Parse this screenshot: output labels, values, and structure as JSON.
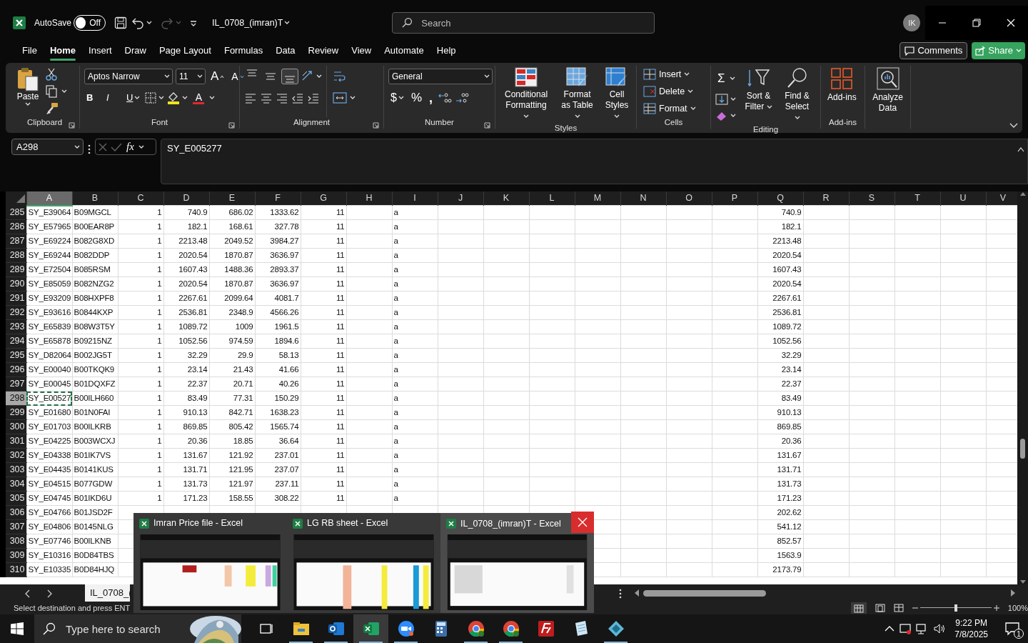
{
  "title_bar": {
    "autosave_label": "AutoSave",
    "autosave": {
      "on": false,
      "label": "Off"
    },
    "file_name": "IL_0708_(imran)T",
    "search_placeholder": "Search",
    "avatar": "IK"
  },
  "menu_tabs": [
    {
      "label": "File",
      "selected": false
    },
    {
      "label": "Home",
      "selected": true
    },
    {
      "label": "Insert",
      "selected": false
    },
    {
      "label": "Draw",
      "selected": false
    },
    {
      "label": "Page Layout",
      "selected": false
    },
    {
      "label": "Formulas",
      "selected": false
    },
    {
      "label": "Data",
      "selected": false
    },
    {
      "label": "Review",
      "selected": false
    },
    {
      "label": "View",
      "selected": false
    },
    {
      "label": "Automate",
      "selected": false
    },
    {
      "label": "Help",
      "selected": false
    }
  ],
  "comments": "Comments",
  "share": "Share",
  "ribbon": {
    "clipboard": {
      "label": "Clipboard",
      "paste": "Paste"
    },
    "font": {
      "label": "Font",
      "family": "Aptos Narrow",
      "size": "11",
      "grow": "A",
      "shrink": "A",
      "bold": "B",
      "italic": "I",
      "underline": "U",
      "color_letter": "A"
    },
    "alignment": {
      "label": "Alignment",
      "vertical": [
        {
          "selected": false
        },
        {
          "selected": false
        },
        {
          "selected": true
        }
      ]
    },
    "number": {
      "label": "Number",
      "format": "General",
      "currency": "$",
      "percent": "%",
      "comma": ","
    },
    "styles": {
      "label": "Styles",
      "buttons": [
        "Conditional Formatting",
        "Format as Table",
        "Cell Styles"
      ]
    },
    "cells": {
      "label": "Cells",
      "buttons": [
        "Insert",
        "Delete",
        "Format"
      ]
    },
    "editing": {
      "label": "Editing",
      "sum": "Σ",
      "buttons": [
        "Sort & Filter",
        "Find & Select"
      ]
    },
    "addins": {
      "label": "Add-ins",
      "button": "Add-ins"
    },
    "analyze": {
      "button": "Analyze Data"
    }
  },
  "formula_bar": {
    "name_box": "A298",
    "fx": "fx",
    "formula": "SY_E005277"
  },
  "columns": [
    {
      "letter": "A",
      "numeric": false,
      "selected": true
    },
    {
      "letter": "B",
      "numeric": false,
      "selected": false
    },
    {
      "letter": "C",
      "numeric": true,
      "selected": false
    },
    {
      "letter": "D",
      "numeric": true,
      "selected": false
    },
    {
      "letter": "E",
      "numeric": true,
      "selected": false
    },
    {
      "letter": "F",
      "numeric": true,
      "selected": false
    },
    {
      "letter": "G",
      "numeric": true,
      "selected": false
    },
    {
      "letter": "H",
      "selected": false
    },
    {
      "letter": "I",
      "numeric": false,
      "selected": false
    },
    {
      "letter": "J",
      "selected": false
    },
    {
      "letter": "K",
      "selected": false
    },
    {
      "letter": "L",
      "selected": false
    },
    {
      "letter": "M",
      "selected": false
    },
    {
      "letter": "N",
      "selected": false
    },
    {
      "letter": "O",
      "selected": false
    },
    {
      "letter": "P",
      "selected": false
    },
    {
      "letter": "Q",
      "numeric": true,
      "selected": false
    },
    {
      "letter": "R",
      "selected": false
    },
    {
      "letter": "S",
      "selected": false
    },
    {
      "letter": "T",
      "selected": false
    },
    {
      "letter": "U",
      "selected": false
    },
    {
      "letter": "V",
      "selected": false
    }
  ],
  "rows": [
    {
      "number": "285",
      "selected": false,
      "cells": {
        "A": "SY_E39064",
        "B": "B09MGCL",
        "C": "1",
        "D": "740.9",
        "E": "686.02",
        "F": "1333.62",
        "G": "11",
        "I": "a",
        "Q": "740.9"
      }
    },
    {
      "number": "286",
      "selected": false,
      "cells": {
        "A": "SY_E57965",
        "B": "B00EAR8P",
        "C": "1",
        "D": "182.1",
        "E": "168.61",
        "F": "327.78",
        "G": "11",
        "I": "a",
        "Q": "182.1"
      }
    },
    {
      "number": "287",
      "selected": false,
      "cells": {
        "A": "SY_E69224",
        "B": "B082G8XD",
        "C": "1",
        "D": "2213.48",
        "E": "2049.52",
        "F": "3984.27",
        "G": "11",
        "I": "a",
        "Q": "2213.48"
      }
    },
    {
      "number": "288",
      "selected": false,
      "cells": {
        "A": "SY_E69244",
        "B": "B082DDP",
        "C": "1",
        "D": "2020.54",
        "E": "1870.87",
        "F": "3636.97",
        "G": "11",
        "I": "a",
        "Q": "2020.54"
      }
    },
    {
      "number": "289",
      "selected": false,
      "cells": {
        "A": "SY_E72504",
        "B": "B085RSM",
        "C": "1",
        "D": "1607.43",
        "E": "1488.36",
        "F": "2893.37",
        "G": "11",
        "I": "a",
        "Q": "1607.43"
      }
    },
    {
      "number": "290",
      "selected": false,
      "cells": {
        "A": "SY_E85059",
        "B": "B082NZG2",
        "C": "1",
        "D": "2020.54",
        "E": "1870.87",
        "F": "3636.97",
        "G": "11",
        "I": "a",
        "Q": "2020.54"
      }
    },
    {
      "number": "291",
      "selected": false,
      "cells": {
        "A": "SY_E93209",
        "B": "B08HXPF8",
        "C": "1",
        "D": "2267.61",
        "E": "2099.64",
        "F": "4081.7",
        "G": "11",
        "I": "a",
        "Q": "2267.61"
      }
    },
    {
      "number": "292",
      "selected": false,
      "cells": {
        "A": "SY_E93616",
        "B": "B0844KXP",
        "C": "1",
        "D": "2536.81",
        "E": "2348.9",
        "F": "4566.26",
        "G": "11",
        "I": "a",
        "Q": "2536.81"
      }
    },
    {
      "number": "293",
      "selected": false,
      "cells": {
        "A": "SY_E65839",
        "B": "B08W3T5Y",
        "C": "1",
        "D": "1089.72",
        "E": "1009",
        "F": "1961.5",
        "G": "11",
        "I": "a",
        "Q": "1089.72"
      }
    },
    {
      "number": "294",
      "selected": false,
      "cells": {
        "A": "SY_E65878",
        "B": "B09215NZ",
        "C": "1",
        "D": "1052.56",
        "E": "974.59",
        "F": "1894.6",
        "G": "11",
        "I": "a",
        "Q": "1052.56"
      }
    },
    {
      "number": "295",
      "selected": false,
      "cells": {
        "A": "SY_D82064",
        "B": "B002JG5T",
        "C": "1",
        "D": "32.29",
        "E": "29.9",
        "F": "58.13",
        "G": "11",
        "I": "a",
        "Q": "32.29"
      }
    },
    {
      "number": "296",
      "selected": false,
      "cells": {
        "A": "SY_E00040",
        "B": "B00TKQK9",
        "C": "1",
        "D": "23.14",
        "E": "21.43",
        "F": "41.66",
        "G": "11",
        "I": "a",
        "Q": "23.14"
      }
    },
    {
      "number": "297",
      "selected": false,
      "cells": {
        "A": "SY_E00045",
        "B": "B01DQXFZ",
        "C": "1",
        "D": "22.37",
        "E": "20.71",
        "F": "40.26",
        "G": "11",
        "I": "a",
        "Q": "22.37"
      }
    },
    {
      "number": "298",
      "selected": true,
      "cells": {
        "A": "SY_E00527",
        "B": "B00ILH660",
        "C": "1",
        "D": "83.49",
        "E": "77.31",
        "F": "150.29",
        "G": "11",
        "I": "a",
        "Q": "83.49"
      }
    },
    {
      "number": "299",
      "selected": false,
      "cells": {
        "A": "SY_E01680",
        "B": "B01N0FAI",
        "C": "1",
        "D": "910.13",
        "E": "842.71",
        "F": "1638.23",
        "G": "11",
        "I": "a",
        "Q": "910.13"
      }
    },
    {
      "number": "300",
      "selected": false,
      "cells": {
        "A": "SY_E01703",
        "B": "B00ILKRB",
        "C": "1",
        "D": "869.85",
        "E": "805.42",
        "F": "1565.74",
        "G": "11",
        "I": "a",
        "Q": "869.85"
      }
    },
    {
      "number": "301",
      "selected": false,
      "cells": {
        "A": "SY_E04225",
        "B": "B003WCXJ",
        "C": "1",
        "D": "20.36",
        "E": "18.85",
        "F": "36.64",
        "G": "11",
        "I": "a",
        "Q": "20.36"
      }
    },
    {
      "number": "302",
      "selected": false,
      "cells": {
        "A": "SY_E04338",
        "B": "B01IK7VS",
        "C": "1",
        "D": "131.67",
        "E": "121.92",
        "F": "237.01",
        "G": "11",
        "I": "a",
        "Q": "131.67"
      }
    },
    {
      "number": "303",
      "selected": false,
      "cells": {
        "A": "SY_E04435",
        "B": "B0141KUS",
        "C": "1",
        "D": "131.71",
        "E": "121.95",
        "F": "237.07",
        "G": "11",
        "I": "a",
        "Q": "131.71"
      }
    },
    {
      "number": "304",
      "selected": false,
      "cells": {
        "A": "SY_E04515",
        "B": "B077GDW",
        "C": "1",
        "D": "131.73",
        "E": "121.97",
        "F": "237.11",
        "G": "11",
        "I": "a",
        "Q": "131.73"
      }
    },
    {
      "number": "305",
      "selected": false,
      "cells": {
        "A": "SY_E04745",
        "B": "B01IKD6U",
        "C": "1",
        "D": "171.23",
        "E": "158.55",
        "F": "308.22",
        "G": "11",
        "I": "a",
        "Q": "171.23"
      }
    },
    {
      "number": "306",
      "selected": false,
      "cells": {
        "A": "SY_E04766",
        "B": "B01JSD2F",
        "Q": "202.62"
      }
    },
    {
      "number": "307",
      "selected": false,
      "cells": {
        "A": "SY_E04806",
        "B": "B0145NLG",
        "Q": "541.12"
      }
    },
    {
      "number": "308",
      "selected": false,
      "cells": {
        "A": "SY_E07746",
        "B": "B00ILKNB",
        "Q": "852.57"
      }
    },
    {
      "number": "309",
      "selected": false,
      "cells": {
        "A": "SY_E10316",
        "B": "B0D84TBS",
        "Q": "1563.9"
      }
    },
    {
      "number": "310",
      "selected": false,
      "cells": {
        "A": "SY_E10335",
        "B": "B0D84HJQ",
        "Q": "2173.79"
      }
    }
  ],
  "sheet_tab": "IL_0708_(",
  "status_bar": {
    "message": "Select destination and press ENT",
    "zoom": "100%",
    "level": 0.5
  },
  "thumbnails": [
    {
      "title": "Imran Price file - Excel",
      "selected": false
    },
    {
      "title": "LG RB sheet - Excel",
      "selected": false
    },
    {
      "title": "IL_0708_(imran)T - Excel",
      "selected": true
    }
  ],
  "taskbar": {
    "search_placeholder": "Type here to search",
    "time": "9:22 PM",
    "date": "7/8/2025",
    "notifications": "1"
  }
}
